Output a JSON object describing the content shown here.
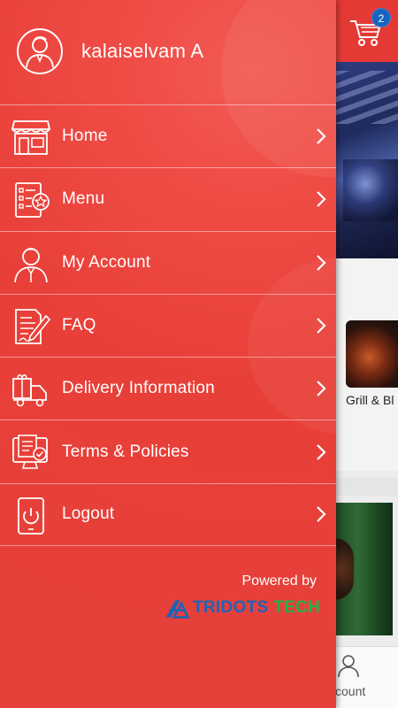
{
  "cart": {
    "badge_count": "2",
    "icon": "cart-icon"
  },
  "background": {
    "product_caption": "Grill & Bl",
    "bottom_nav_label": "ccount"
  },
  "drawer": {
    "user": {
      "name": "kalaiselvam A",
      "icon": "user-avatar-icon"
    },
    "menu": [
      {
        "label": "Home",
        "icon": "shop-icon"
      },
      {
        "label": "Menu",
        "icon": "menu-list-icon"
      },
      {
        "label": "My Account",
        "icon": "account-icon"
      },
      {
        "label": "FAQ",
        "icon": "faq-icon"
      },
      {
        "label": "Delivery Information",
        "icon": "delivery-truck-icon"
      },
      {
        "label": "Terms & Policies",
        "icon": "terms-policies-icon"
      },
      {
        "label": "Logout",
        "icon": "logout-power-icon"
      }
    ],
    "footer": {
      "powered_by": "Powered by",
      "brand_part1": "TRIDOTS",
      "brand_part2": "TECH"
    }
  },
  "colors": {
    "accent": "#e84039",
    "badge": "#1565c0",
    "brand_blue": "#1f63b6",
    "brand_green": "#22b14c"
  }
}
